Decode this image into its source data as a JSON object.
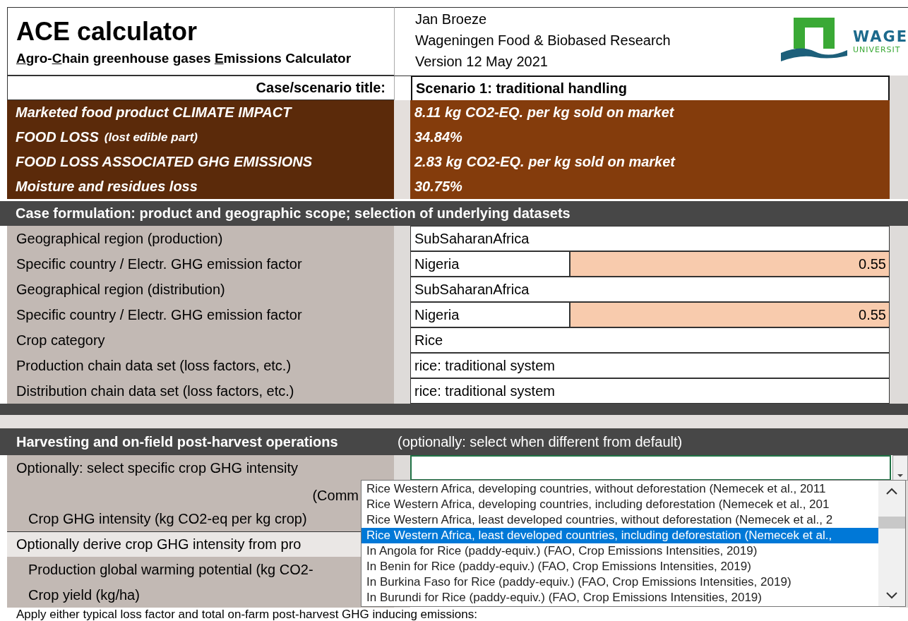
{
  "header": {
    "title": "ACE calculator",
    "subtitle_parts": [
      {
        "text": "A",
        "underlined": true
      },
      {
        "text": "gro-",
        "underlined": false
      },
      {
        "text": "C",
        "underlined": true
      },
      {
        "text": "hain greenhouse gases ",
        "underlined": false
      },
      {
        "text": "E",
        "underlined": true
      },
      {
        "text": "missions Calculator",
        "underlined": false
      }
    ],
    "author": "Jan Broeze",
    "organisation": "Wageningen Food & Biobased Research",
    "version": "Version 12 May 2021",
    "logo": {
      "line_1": "WAGE",
      "line_2": "UNIVERSIT"
    }
  },
  "scenario": {
    "label": "Case/scenario title:",
    "value": "Scenario 1: traditional handling"
  },
  "results": [
    {
      "label": "Marketed food product CLIMATE IMPACT",
      "value": "8.11 kg CO2-EQ. per kg sold on market"
    },
    {
      "label": "FOOD LOSS",
      "note": "(lost edible part)",
      "value": "34.84%"
    },
    {
      "label": "FOOD LOSS ASSOCIATED GHG EMISSIONS",
      "value": "2.83 kg CO2-EQ. per kg sold on market"
    },
    {
      "label": "Moisture and residues loss",
      "value": "30.75%"
    }
  ],
  "case_section": {
    "title": "Case formulation: product and geographic scope; selection of underlying datasets",
    "rows": [
      {
        "label": "Geographical region (production)",
        "value": "SubSaharanAfrica"
      },
      {
        "label": "Specific country / Electr. GHG emission factor",
        "value": "Nigeria",
        "factor": "0.55"
      },
      {
        "label": "Geographical region (distribution)",
        "value": "SubSaharanAfrica"
      },
      {
        "label": "Specific country / Electr. GHG emission factor",
        "value": "Nigeria",
        "factor": "0.55"
      },
      {
        "label": "Crop category",
        "value": "Rice"
      },
      {
        "label": "Production chain data set (loss factors, etc.)",
        "value": "rice: traditional system"
      },
      {
        "label": "Distribution chain data set (loss factors, etc.)",
        "value": "rice: traditional system"
      }
    ]
  },
  "harvest_section": {
    "title": "Harvesting and on-field post-harvest operations",
    "hint": "(optionally: select when different from default)",
    "rows": [
      {
        "kind": "select",
        "label": "Optionally: select specific crop GHG intensity"
      },
      {
        "kind": "note",
        "label": "(Comm"
      },
      {
        "kind": "indented",
        "label": "Crop GHG intensity (kg CO2-eq per kg crop)"
      },
      {
        "kind": "heading",
        "label": "Optionally derive crop GHG intensity from pro"
      },
      {
        "kind": "indented",
        "label": "Production global warming potential (kg CO2-"
      },
      {
        "kind": "indented",
        "label": "Crop yield (kg/ha)"
      },
      {
        "kind": "wide",
        "label": "Apply either typical loss factor and total on-farm post-harvest GHG inducing emissions:"
      }
    ]
  },
  "dropdown": {
    "items": [
      {
        "text": "Rice Western Africa, developing countries, without deforestation (Nemecek et al., 2011",
        "selected": false
      },
      {
        "text": "Rice Western Africa, developing countries, including deforestation (Nemecek et al., 201",
        "selected": false
      },
      {
        "text": "Rice Western Africa, least developed countries, without deforestation (Nemecek et al., 2",
        "selected": false
      },
      {
        "text": "Rice Western Africa, least developed countries, including deforestation (Nemecek et al.,",
        "selected": true
      },
      {
        "text": "In Angola for Rice (paddy-equiv.) (FAO, Crop Emissions Intensities, 2019)",
        "selected": false
      },
      {
        "text": "In Benin for Rice (paddy-equiv.) (FAO, Crop Emissions Intensities, 2019)",
        "selected": false
      },
      {
        "text": "In Burkina Faso for Rice (paddy-equiv.) (FAO, Crop Emissions Intensities, 2019)",
        "selected": false
      },
      {
        "text": "In Burundi for Rice (paddy-equiv.) (FAO, Crop Emissions Intensities, 2019)",
        "selected": false
      }
    ]
  }
}
